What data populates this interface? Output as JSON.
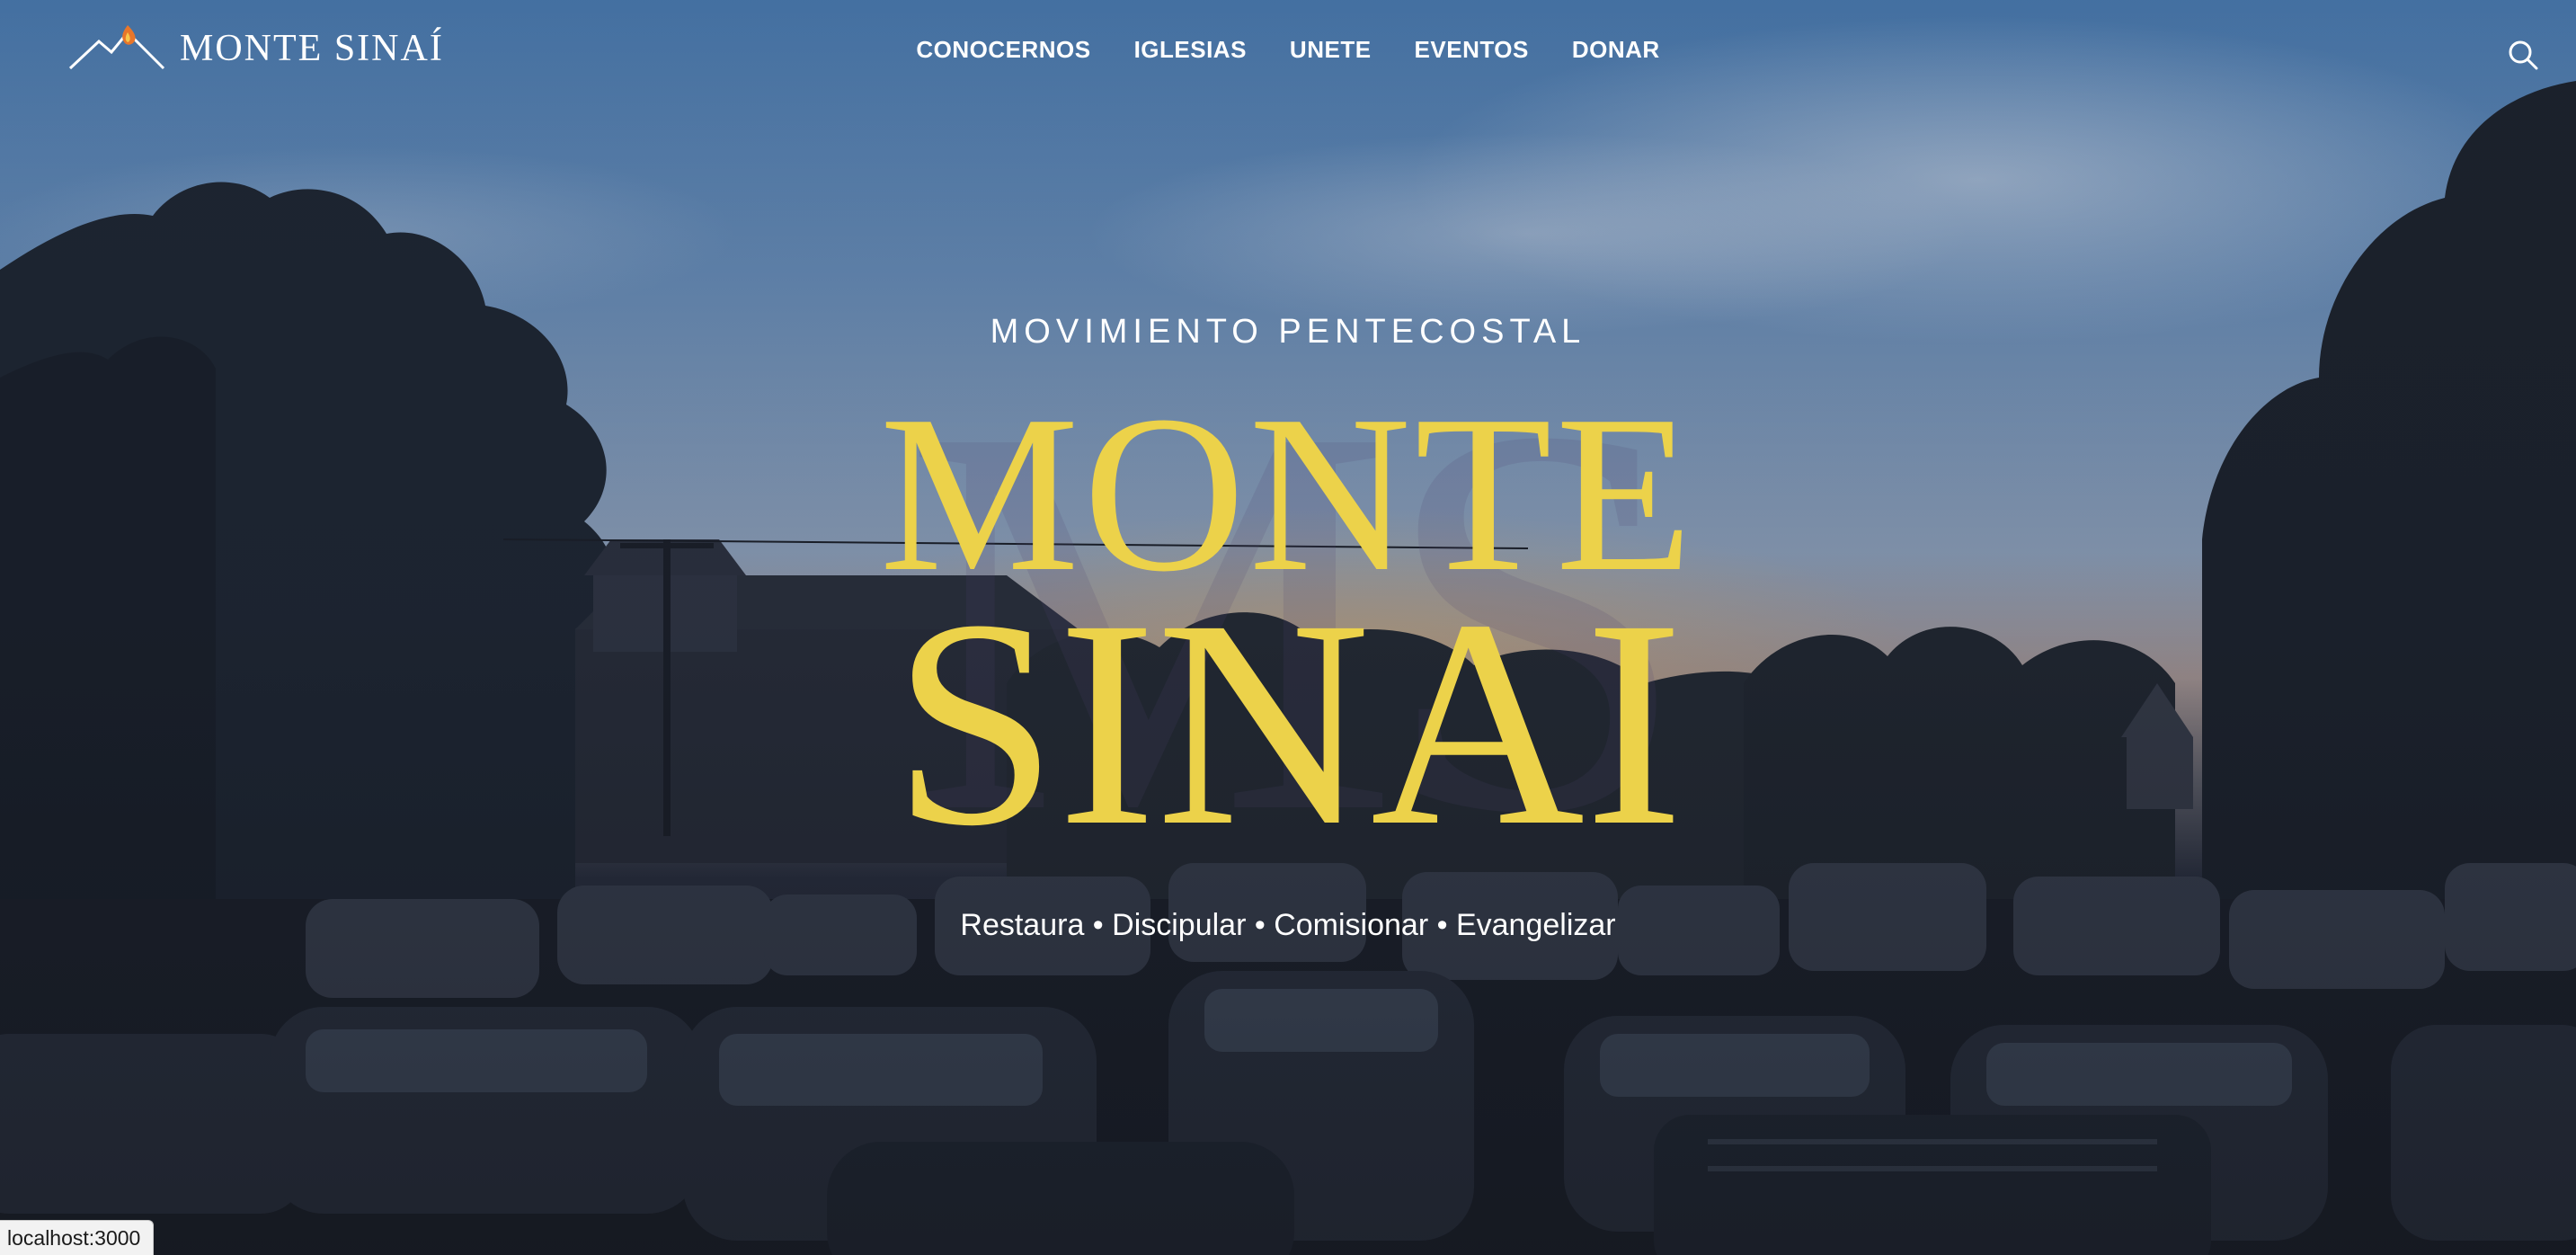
{
  "logo": {
    "text": "MONTE SINAÍ",
    "icon": "mountain-flame-icon"
  },
  "nav": {
    "items": [
      {
        "label": "CONOCERNOS"
      },
      {
        "label": "IGLESIAS"
      },
      {
        "label": "UNETE"
      },
      {
        "label": "EVENTOS"
      },
      {
        "label": "DONAR"
      }
    ],
    "search_icon": "search-icon"
  },
  "hero": {
    "kicker": "MOVIMIENTO PENTECOSTAL",
    "title_line1": "MONTE",
    "title_line2": "SINAI",
    "watermark": "MS",
    "tagline": "Restaura • Discipular • Comisionar • Evangelizar",
    "background": "sunset-parking-lot-photo"
  },
  "status_bar": {
    "url": "localhost:3000"
  },
  "colors": {
    "accent": "#ecd24a",
    "nav_text": "#ffffff",
    "flame": "#e8762a"
  }
}
